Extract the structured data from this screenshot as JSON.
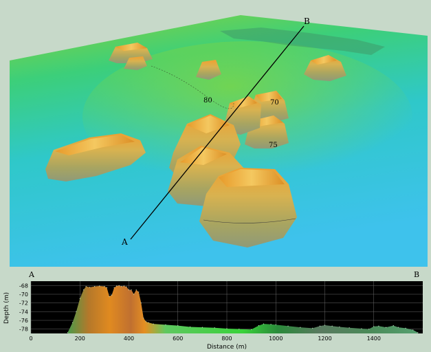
{
  "scene": {
    "point_a": "A",
    "point_b": "B",
    "contour_labels": [
      "80",
      "70",
      "75"
    ]
  },
  "profile": {
    "start_label": "A",
    "end_label": "B"
  },
  "chart_data": {
    "type": "area",
    "xlabel": "Distance (m)",
    "ylabel": "Depth (m)",
    "xlim": [
      0,
      1600
    ],
    "ylim": [
      -79,
      -67
    ],
    "x_ticks": [
      0,
      200,
      400,
      600,
      800,
      1000,
      1200,
      1400
    ],
    "y_ticks": [
      -68,
      -70,
      -72,
      -74,
      -76,
      -78
    ],
    "grid": true,
    "series": [
      {
        "x": [
          150,
          170,
          185,
          200,
          215,
          225,
          240,
          260,
          280,
          300,
          310,
          320,
          330,
          340,
          350,
          360,
          370,
          380,
          390,
          400,
          410,
          420,
          430,
          440,
          450,
          460,
          470,
          480,
          500,
          550,
          600,
          650,
          700,
          750,
          800,
          850,
          900,
          930,
          950,
          980,
          1000,
          1050,
          1100,
          1150,
          1180,
          1200,
          1230,
          1260,
          1300,
          1350,
          1380,
          1400,
          1420,
          1450,
          1480,
          1500,
          1530,
          1560,
          1580
        ],
        "values": [
          -78.8,
          -76.5,
          -74,
          -71,
          -69,
          -68.2,
          -68.4,
          -68.2,
          -68.1,
          -68.2,
          -68.5,
          -70.5,
          -70.2,
          -68.5,
          -68.1,
          -68.0,
          -68.2,
          -68.1,
          -68.3,
          -69.0,
          -69.0,
          -70.0,
          -69.0,
          -69.5,
          -72,
          -75.5,
          -76.3,
          -76.5,
          -76.8,
          -77.0,
          -77.2,
          -77.5,
          -77.6,
          -77.7,
          -77.9,
          -78.0,
          -78.1,
          -77.2,
          -76.8,
          -76.9,
          -77.0,
          -77.3,
          -77.6,
          -77.8,
          -77.3,
          -77.1,
          -77.3,
          -77.5,
          -77.7,
          -77.9,
          -78.0,
          -77.4,
          -77.3,
          -77.6,
          -77.2,
          -77.6,
          -77.8,
          -78.2,
          -78.8
        ]
      }
    ]
  }
}
